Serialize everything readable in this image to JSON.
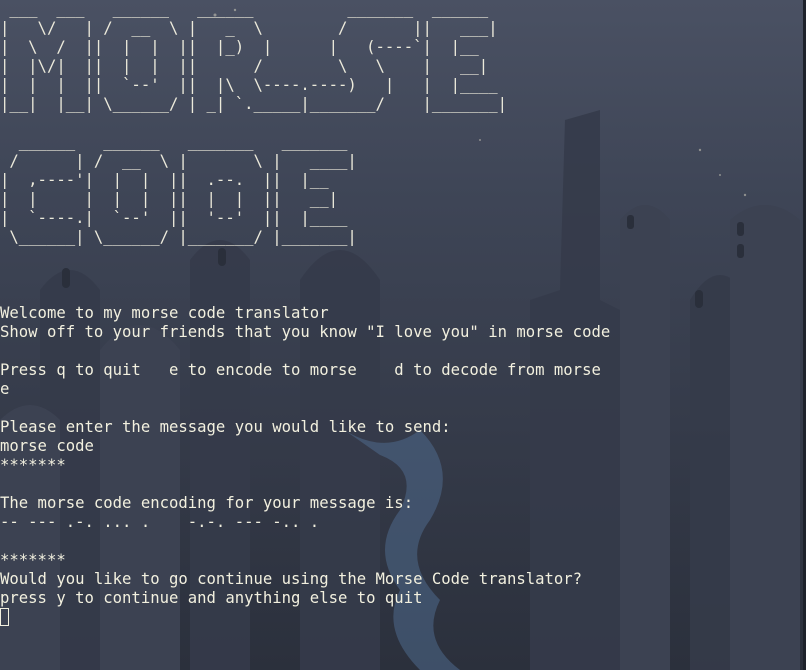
{
  "banner": {
    "morse_art": [
      " ___  ___   ______   ______          _______  ______",
      "|   \\/   | /  __  \\ |   _  \\        /       ||   ___|",
      "|  \\  /  ||  |  |  ||  |_)  |      |   (----`|  |__",
      "|  |\\/|  ||  |  |  ||      /        \\   \\    |   __|",
      "|  |  |  ||  `--'  ||  |\\  \\----.----)   |   |  |____",
      "|__|  |__| \\______/ | _| `._____|_______/    |_______|"
    ],
    "code_art": [
      "  ______   ______   _______   _______",
      " /      | /  __  \\ |       \\ |   ____|",
      "|  ,----'|  |  |  ||  .--.  ||  |__",
      "|  |     |  |  |  ||  |  |  ||   __|",
      "|  `----.|  `--'  ||  '--'  ||  |____",
      " \\______| \\______/ |_______/ |_______|"
    ]
  },
  "session": {
    "welcome": "Welcome to my morse code translator",
    "tagline": "Show off to your friends that you know \"I love you\" in morse code",
    "menu": "Press q to quit   e to encode to morse    d to decode from morse",
    "choice": "e",
    "prompt": "Please enter the message you would like to send:",
    "user_message": "morse code",
    "separator_top": "*******",
    "result_label": "The morse code encoding for your message is:",
    "encoded": "-- --- .-. ... .    -.-. --- -.. .",
    "separator_bottom": "*******",
    "continue_question": "Would you like to go continue using the Morse Code translator?",
    "continue_hint": "press y to continue and anything else to quit"
  },
  "colors": {
    "text": "#f2f0df",
    "background": "#3e4556"
  }
}
